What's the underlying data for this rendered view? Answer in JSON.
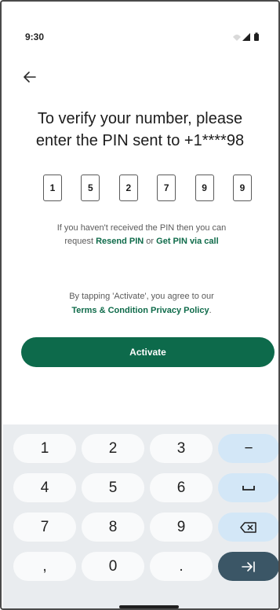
{
  "status": {
    "time": "9:30"
  },
  "screen": {
    "title_line1": "To verify your number, please",
    "title_line2": "enter the PIN sent to +1****98",
    "pin_digits": [
      "1",
      "5",
      "2",
      "7",
      "9",
      "9"
    ],
    "help_line1": "If you haven't received the PIN then you can",
    "help_prefix": "request ",
    "resend_link": "Resend PIN",
    "help_or": " or ",
    "call_link": "Get PIN via call",
    "terms_line1": "By tapping 'Activate', you agree to our",
    "terms_link": "Terms & Condition",
    "privacy_link": "Privacy Policy",
    "terms_end": ".",
    "activate_label": "Activate"
  },
  "keyboard": {
    "rows": [
      [
        "1",
        "2",
        "3",
        "−"
      ],
      [
        "4",
        "5",
        "6",
        "␣"
      ],
      [
        "7",
        "8",
        "9",
        "⌫"
      ],
      [
        ",",
        "0",
        ".",
        "→|"
      ]
    ]
  },
  "colors": {
    "accent": "#0d6a4b",
    "link": "#0f6b4a",
    "keyboard_bg": "#e9ecef",
    "fn_key": "#d3e7f7",
    "enter_key": "#3b5666"
  }
}
